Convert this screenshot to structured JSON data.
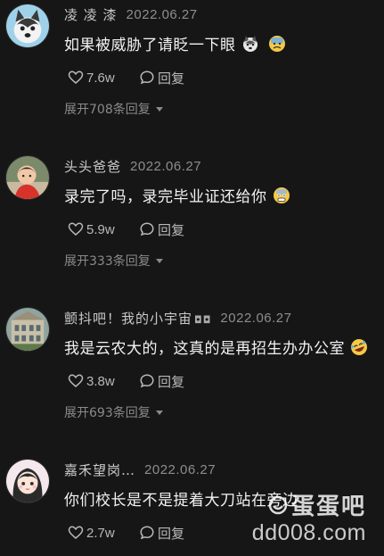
{
  "comments": [
    {
      "username": "凌 凌 漆",
      "timestamp": "2022.06.27",
      "text": "如果被威胁了请眨一下眼",
      "emojis": [
        "husky-face-icon",
        "cold-sweat-emoji"
      ],
      "likes": "7.6w",
      "reply_label": "回复",
      "expand_label": "展开708条回复"
    },
    {
      "username": "头头爸爸",
      "timestamp": "2022.06.27",
      "text": "录完了吗，录完毕业证还给你",
      "emojis": [
        "fearful-emoji"
      ],
      "likes": "5.9w",
      "reply_label": "回复",
      "expand_label": "展开333条回复"
    },
    {
      "username": "颤抖吧！我的小宇宙",
      "username_tag": "◘◘",
      "timestamp": "2022.06.27",
      "text": "我是云农大的，这真的是再招生办办公室",
      "emojis": [
        "rofl-emoji"
      ],
      "likes": "3.8w",
      "reply_label": "回复",
      "expand_label": "展开693条回复"
    },
    {
      "username": "嘉禾望岗…",
      "timestamp": "2022.06.27",
      "text": "你们校长是不是提着大刀站在旁边",
      "emojis": [],
      "likes": "2.7w",
      "reply_label": "回复"
    }
  ],
  "watermark": {
    "logo_text": "蛋蛋吧",
    "url": "dd008.com"
  },
  "colors": {
    "background": "#161616",
    "text_primary": "#f2f2f2",
    "text_secondary": "#8d8d8d"
  }
}
